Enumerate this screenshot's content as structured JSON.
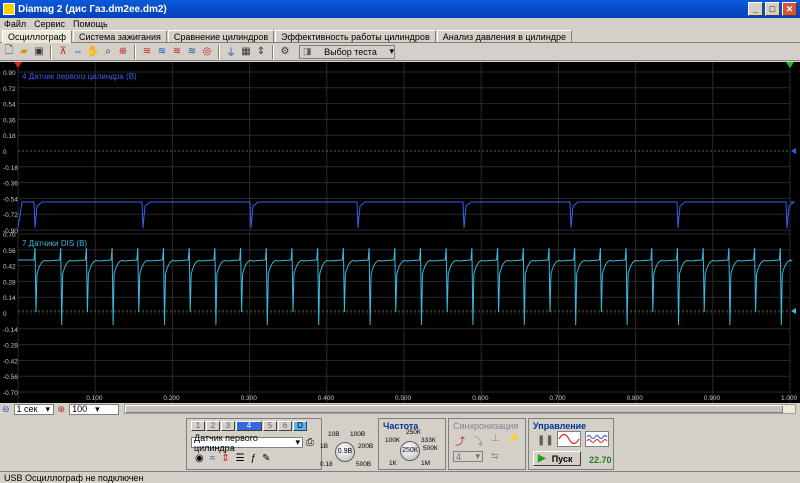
{
  "window": {
    "title": "Diamag 2 (дис Газ.dm2ee.dm2)"
  },
  "menu": [
    "Файл",
    "Сервис",
    "Помощь"
  ],
  "tabs": [
    "Осциллограф",
    "Система зажигания",
    "Сравнение цилиндров",
    "Эффективность работы цилиндров",
    "Анализ давления в цилиндре"
  ],
  "toolbar": {
    "test_select": "Выбор теста"
  },
  "scope": {
    "ch1_label": "4 Датчик первого цилиндра (В)",
    "ch2_label": "7 Датчики DIS (В)",
    "ch1_ticks": [
      "0.90",
      "0.72",
      "0.54",
      "0.36",
      "0.18",
      "0",
      "-0.18",
      "-0.36",
      "-0.54",
      "-0.72",
      "-0.90"
    ],
    "ch2_ticks": [
      "0.70",
      "0.56",
      "0.42",
      "0.28",
      "0.14",
      "0",
      "-0.14",
      "-0.28",
      "-0.42",
      "-0.56",
      "-0.70"
    ],
    "time_ticks": [
      "0.100",
      "0.200",
      "0.300",
      "0.400",
      "0.500",
      "0.600",
      "0.700",
      "0.800",
      "0.900",
      "1.000"
    ],
    "colors": {
      "ch1": "#3a5ff0",
      "ch2": "#3ab8e0",
      "grid": "#2a2a2a"
    }
  },
  "controls": {
    "timebase": "1 сек",
    "zoom": "100"
  },
  "bottom": {
    "channels": [
      "1",
      "2",
      "3",
      "4",
      "5",
      "6",
      "D"
    ],
    "sensor_select": "Датчик первого цилиндра",
    "voltage_dial": {
      "value": "0.9В",
      "labels": [
        "10В",
        "100В",
        "1В",
        "200В",
        "0.18",
        "500В"
      ]
    },
    "freq": {
      "title": "Частота",
      "value": "250К",
      "labels": [
        "250К",
        "100К",
        "333К",
        "500К",
        "1К",
        "1М"
      ]
    },
    "sync": {
      "title": "Синхронизация",
      "value": "4"
    },
    "control": {
      "title": "Управление",
      "start_label": "Пуск",
      "value": "22.70"
    }
  },
  "status": {
    "text": "USB Осциллограф не подключен"
  }
}
